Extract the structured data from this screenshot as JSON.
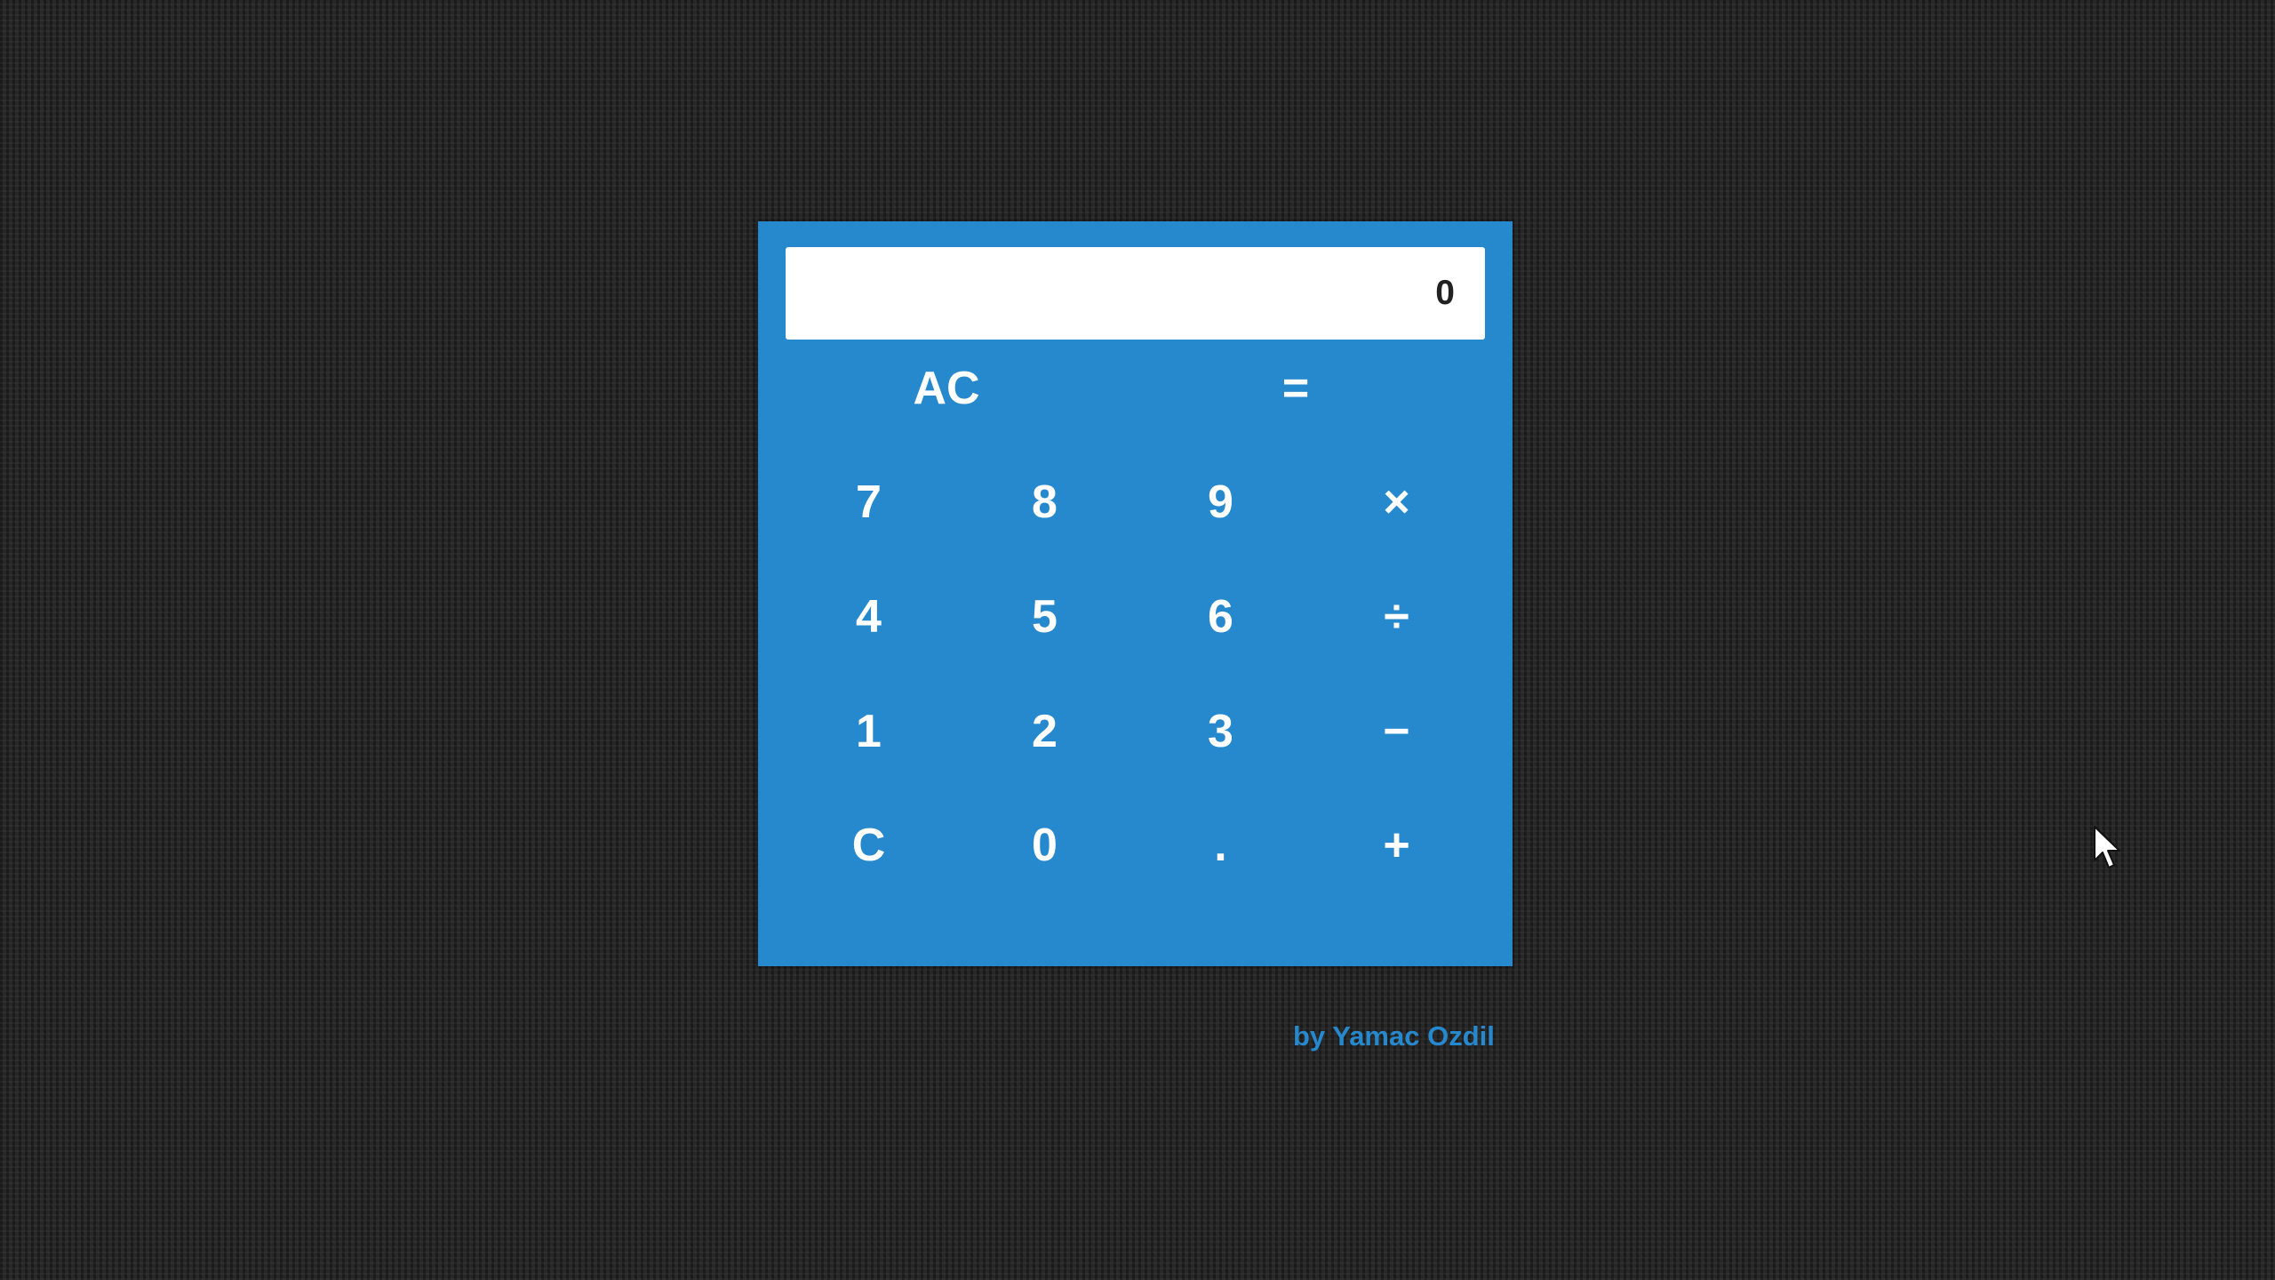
{
  "display": {
    "value": "0"
  },
  "keys": {
    "ac": "AC",
    "equals": "=",
    "seven": "7",
    "eight": "8",
    "nine": "9",
    "multiply": "×",
    "four": "4",
    "five": "5",
    "six": "6",
    "divide": "÷",
    "one": "1",
    "two": "2",
    "three": "3",
    "subtract": "−",
    "clear": "C",
    "zero": "0",
    "decimal": ".",
    "add": "+"
  },
  "credit": {
    "text": "by Yamac Ozdil"
  },
  "colors": {
    "calculator_bg": "#2789cd",
    "display_bg": "#ffffff",
    "key_text": "#ffffff",
    "credit_text": "#2789cd",
    "page_bg": "#232323"
  },
  "icons": {
    "cursor": "mouse-pointer-icon"
  }
}
